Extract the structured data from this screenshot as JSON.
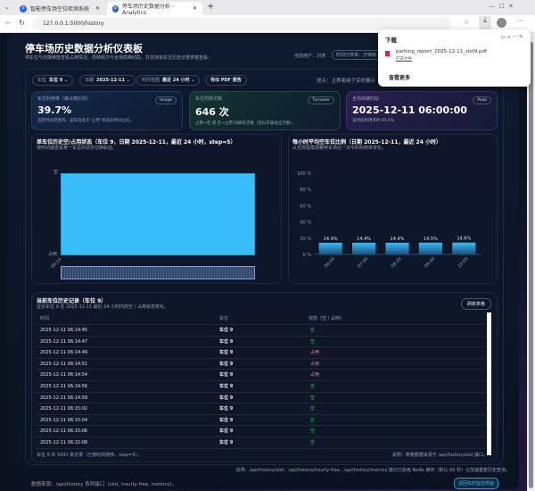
{
  "browser": {
    "tabs": [
      {
        "title": "智能停车场空位检测系统"
      },
      {
        "title": "停车场历史数据分析 - Analytics"
      }
    ],
    "url": "127.0.0.1:5000/history"
  },
  "downloads": {
    "title": "下载",
    "file": "parking_report_2025-12-11_slot9.pdf",
    "action": "打开文件",
    "more": "查看更多"
  },
  "header": {
    "title": "停车场历史数据分析仪表板",
    "subtitle": "停车位与日期维度查看占用情况、周转频次与全场高峰时段，并支持单车位历史记录表格查看。",
    "user": "当前用户：刘涛",
    "granularity": "时间分辨率：分钟级"
  },
  "controls": {
    "slot_label": "车位",
    "slot_value": "车位 9",
    "date_label": "日期",
    "date_value": "2025-12-11",
    "range_label": "时间范围",
    "range_value": "最近 24 小时",
    "export": "导出 PDF 报告",
    "hint": "提示：主界面用于实时展示"
  },
  "kpis": [
    {
      "title": "车位利用率（被占用比例）",
      "badge": "Usage",
      "value": "39.7%",
      "desc": "选定时间范围内，该车位处于“占用”状态的时间占比。"
    },
    {
      "title": "车位周转次数",
      "badge": "Turnover",
      "value": "646 次",
      "desc": "占用→空 或 空→占用 的换状次数（近似车辆进出次数）。"
    },
    {
      "title": "全场高峰时段",
      "badge": "Peak",
      "value": "2025-12-11 06:00:00",
      "desc": "该时段利用率约 85.6%"
    }
  ],
  "slot_chart": {
    "title": "单车位历史空/占用状态（车位 9，日期 2025-12-11，最近 24 小时，step=5）",
    "subtitle": "按时间轴查看某一车位的状态切换轨迹。",
    "y_top": "空",
    "y_bottom": "占用",
    "x_label": "06:14"
  },
  "chart_data": {
    "type": "bar",
    "title": "每小时平均空车位比例（日期 2025-12-11，最近 24 小时）",
    "subtitle": "从全局视角观察停车场在一天中的利用率变化。",
    "categories": [
      "06:00",
      "07:00",
      "08:00",
      "09:00",
      "10:00"
    ],
    "values": [
      14.4,
      14.4,
      14.4,
      14.5,
      14.6
    ],
    "labels": [
      "14.4%",
      "14.4%",
      "14.4%",
      "14.5%",
      "14.6%"
    ],
    "yticks": [
      "0 %",
      "20 %",
      "40 %",
      "60 %",
      "80 %",
      "100 %"
    ],
    "ylim": [
      0,
      100
    ]
  },
  "table": {
    "title": "当前车位历史记录（车位 9）",
    "subtitle": "显示车位 9 在 2025-12-11 最近 24 小时内的空 / 占用状态变化。",
    "refresh": "刷新表格",
    "headers": [
      "时间",
      "车位",
      "状态（空 / 占用）"
    ],
    "rows": [
      [
        "2025-12-11 06:14:45",
        "车位 9",
        "空"
      ],
      [
        "2025-12-11 06:14:47",
        "车位 9",
        "空"
      ],
      [
        "2025-12-11 06:14:49",
        "车位 9",
        "占用"
      ],
      [
        "2025-12-11 06:14:51",
        "车位 9",
        "占用"
      ],
      [
        "2025-12-11 06:14:54",
        "车位 9",
        "占用"
      ],
      [
        "2025-12-11 06:14:56",
        "车位 9",
        "空"
      ],
      [
        "2025-12-11 06:14:59",
        "车位 9",
        "空"
      ],
      [
        "2025-12-11 06:15:02",
        "车位 9",
        "空"
      ],
      [
        "2025-12-11 06:15:04",
        "车位 9",
        "空"
      ],
      [
        "2025-12-11 06:15:06",
        "车位 9",
        "空"
      ],
      [
        "2025-12-11 06:15:08",
        "车位 9",
        "空"
      ]
    ],
    "footer_left": "车位 9 共 5041 条记录（已按时间排序，step=5）。",
    "footer_right": "说明：表格数据来源于 /api/history/slot 接口。"
  },
  "notes": "说明：/api/history/slot、/api/history/hourly-free、/api/history/metrics 接口已启用 Redis 缓存（默认 60 秒）以加速重复历史查询。",
  "footer": {
    "source": "数据来源：/api/history 系列接口（slot, hourly-free, metrics）。",
    "back": "返回实时监控界面"
  },
  "colors": {
    "accent": "#38bdf8",
    "free": "#22c55e",
    "occupied": "#f472b6"
  }
}
